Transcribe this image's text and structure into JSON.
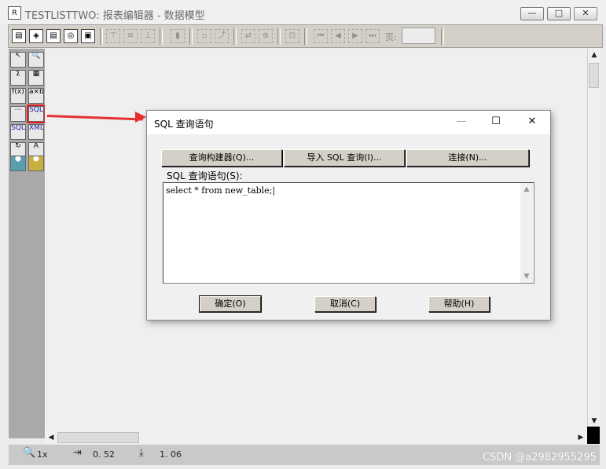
{
  "window": {
    "title": "TESTLISTTWO: 报表编辑器 - 数据模型",
    "icon": "report-editor-icon",
    "controls": {
      "minimize": "—",
      "maximize": "□",
      "close": "✕"
    }
  },
  "toolbar": {
    "page_label": "页:",
    "page_value": ""
  },
  "palette": {
    "tools": [
      {
        "name": "pointer-tool",
        "glyph": "↖"
      },
      {
        "name": "zoom-tool",
        "glyph": "🔍"
      },
      {
        "name": "summary-tool",
        "glyph": "Σ"
      },
      {
        "name": "database-tool",
        "glyph": "▦"
      },
      {
        "name": "formula-tool",
        "glyph": "f(x)"
      },
      {
        "name": "crosstab-tool",
        "glyph": "a×b"
      },
      {
        "name": "placeholder-tool",
        "glyph": "⋯"
      },
      {
        "name": "sql-query-tool",
        "glyph": "SQL"
      },
      {
        "name": "ref-sql-tool",
        "glyph": "SQL"
      },
      {
        "name": "xml-query-tool",
        "glyph": "XML"
      },
      {
        "name": "ref-cursor-tool",
        "glyph": "↻"
      },
      {
        "name": "text-query-tool",
        "glyph": "A"
      },
      {
        "name": "link-tool",
        "glyph": "⬢"
      },
      {
        "name": "group-tool",
        "glyph": "⬢"
      }
    ]
  },
  "status": {
    "zoom": "1x",
    "x": "0. 52",
    "y": "1. 06"
  },
  "watermark": "CSDN @a2982955295",
  "dialog": {
    "title": "SQL 查询语句",
    "controls": {
      "minimize": "—",
      "maximize": "☐",
      "close": "✕"
    },
    "top_buttons": [
      "查询构建器(Q)...",
      "导入 SQL 查询(I)...",
      "连接(N)..."
    ],
    "label": "SQL 查询语句(S):",
    "sql_text": "select * from new_table;|",
    "ok": "确定(O)",
    "cancel": "取消(C)",
    "help": "帮助(H)"
  }
}
